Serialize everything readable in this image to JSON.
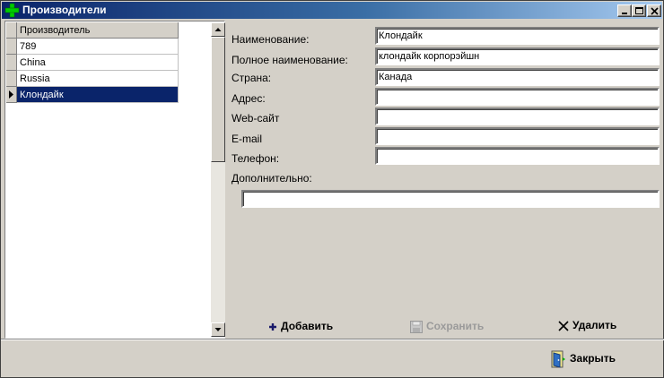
{
  "window": {
    "title": "Производители",
    "icon": "green-plus-icon"
  },
  "title_controls": [
    "minimize-icon",
    "maximize-icon",
    "close-icon"
  ],
  "grid": {
    "column_header": "Производитель",
    "rows": [
      "789",
      "China",
      "Russia",
      "Клондайк"
    ],
    "selected_index": 3
  },
  "form": {
    "labels": {
      "name": "Наименование:",
      "full_name": "Полное наименование:",
      "country": "Страна:",
      "address": "Адрес:",
      "website": "Web-сайт",
      "email": "E-mail",
      "phone": "Телефон:",
      "extra": "Дополнительно:"
    },
    "values": {
      "name": "Клондайк",
      "full_name": "клондайк корпорэйшн",
      "country": "Канада",
      "address": "",
      "website": "",
      "email": "",
      "phone": "",
      "extra": ""
    }
  },
  "actions": {
    "add": "Добавить",
    "save": "Сохранить",
    "delete": "Удалить",
    "close": "Закрыть"
  },
  "colors": {
    "selection": "#0a246a",
    "title_start": "#0a246a",
    "title_end": "#a6caf0",
    "add_icon": "#00cc00"
  }
}
